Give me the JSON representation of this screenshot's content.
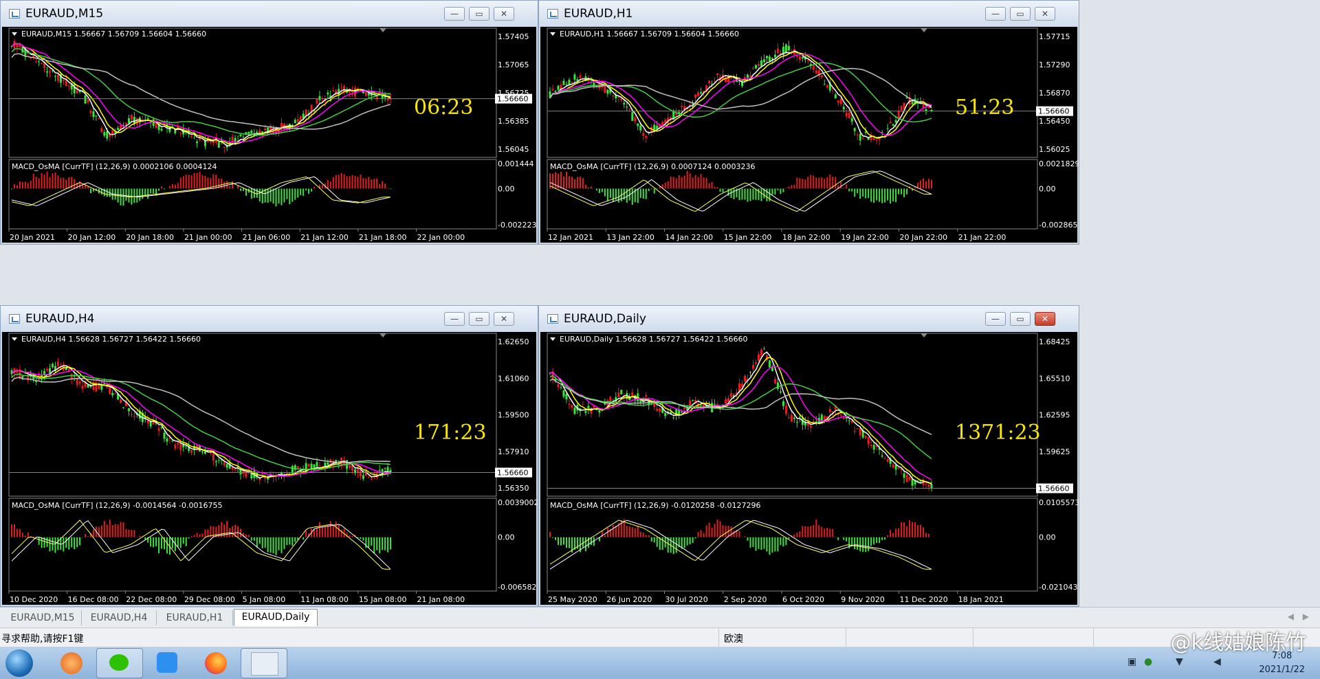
{
  "colors": {
    "bull": "#e02020",
    "bear": "#40e040",
    "price_line": "#808080",
    "ma_white": "#ffffff",
    "ma_yellow": "#ffff00",
    "ma_magenta": "#ff00ff",
    "ma_green": "#44cc44",
    "ma_gray": "#c0c0c0",
    "timer": "#f7e40a"
  },
  "windows": [
    {
      "title": "EURAUD,M15",
      "header": "EURAUD,M15  1.56667 1.56709 1.56604 1.56660",
      "current_price": "1.56660",
      "timer": "06:23",
      "price_labels": [
        "1.57405",
        "1.57065",
        "1.56725",
        "1.56385",
        "1.56045"
      ],
      "macd_header": "MACD_OsMA [CurrTF] (12,26,9) 0.0002106 0.0004124",
      "macd_labels": [
        "0.001444",
        "0.00",
        "-0.0022232"
      ],
      "time_labels": [
        "20 Jan 2021",
        "20 Jan 12:00",
        "20 Jan 18:00",
        "21 Jan 00:00",
        "21 Jan 06:00",
        "21 Jan 12:00",
        "21 Jan 18:00",
        "22 Jan 00:00"
      ],
      "close_red": false
    },
    {
      "title": "EURAUD,H1",
      "header": "EURAUD,H1  1.56667 1.56709 1.56604 1.56660",
      "current_price": "1.56660",
      "timer": "51:23",
      "price_labels": [
        "1.57715",
        "1.57290",
        "1.56870",
        "1.56450",
        "1.56025"
      ],
      "macd_header": "MACD_OsMA [CurrTF] (12,26,9) 0.0007124 0.0003236",
      "macd_labels": [
        "0.0021829",
        "0.00",
        "-0.0028657"
      ],
      "time_labels": [
        "12 Jan 2021",
        "13 Jan 22:00",
        "14 Jan 22:00",
        "15 Jan 22:00",
        "18 Jan 22:00",
        "19 Jan 22:00",
        "20 Jan 22:00",
        "21 Jan 22:00"
      ],
      "close_red": false
    },
    {
      "title": "EURAUD,H4",
      "header": "EURAUD,H4  1.56628 1.56727 1.56422 1.56660",
      "current_price": "1.56660",
      "timer": "171:23",
      "price_labels": [
        "1.62650",
        "1.61060",
        "1.59500",
        "1.57910",
        "1.56350"
      ],
      "macd_header": "MACD_OsMA [CurrTF] (12,26,9) -0.0014564 -0.0016755",
      "macd_labels": [
        "0.0039002",
        "0.00",
        "-0.006582"
      ],
      "time_labels": [
        "10 Dec 2020",
        "16 Dec 08:00",
        "22 Dec 08:00",
        "29 Dec 08:00",
        "5 Jan 08:00",
        "11 Jan 08:00",
        "15 Jan 08:00",
        "21 Jan 08:00"
      ],
      "close_red": false
    },
    {
      "title": "EURAUD,Daily",
      "header": "EURAUD,Daily  1.56628 1.56727 1.56422 1.56660",
      "current_price": "1.56660",
      "timer": "1371:23",
      "price_labels": [
        "1.68425",
        "1.65510",
        "1.62595",
        "1.59625",
        "1.56660"
      ],
      "macd_header": "MACD_OsMA [CurrTF] (12,26,9) -0.0120258 -0.0127296",
      "macd_labels": [
        "0.0105573",
        "0.00",
        "-0.0210437"
      ],
      "time_labels": [
        "25 May 2020",
        "26 Jun 2020",
        "30 Jul 2020",
        "2 Sep 2020",
        "6 Oct 2020",
        "9 Nov 2020",
        "11 Dec 2020",
        "18 Jan 2021"
      ],
      "close_red": true
    }
  ],
  "tabs": [
    "EURAUD,M15",
    "EURAUD,H4",
    "EURAUD,H1",
    "EURAUD,Daily"
  ],
  "active_tab": 3,
  "status": {
    "help": "寻求帮助,请按F1键",
    "symbol": "欧澳"
  },
  "taskbar": {
    "time": "7:08",
    "date": "2021/1/22"
  },
  "watermark": "@k线姑娘陈竹"
}
